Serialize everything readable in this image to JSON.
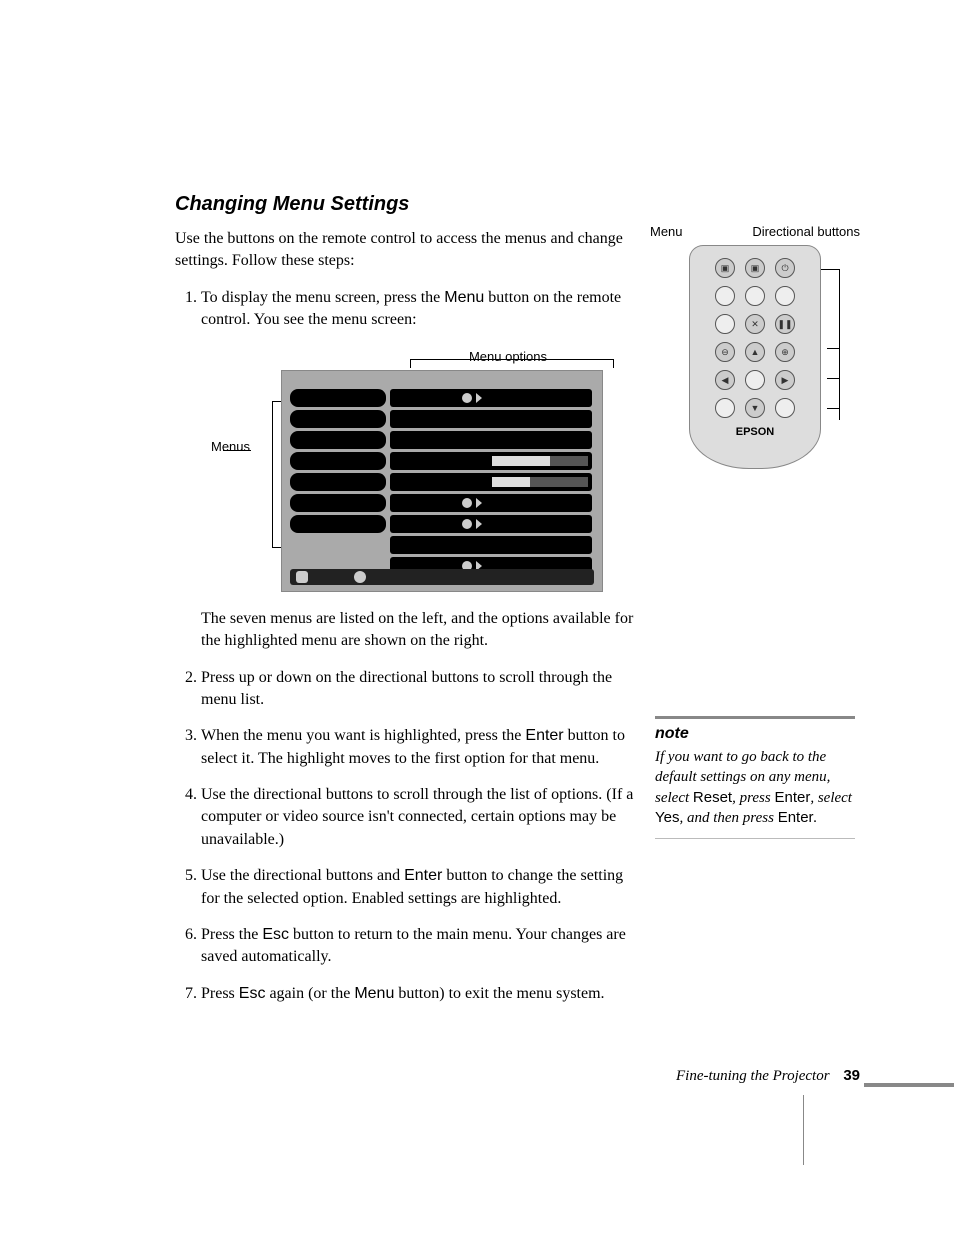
{
  "heading": "Changing Menu Settings",
  "intro": "Use the buttons on the remote control to access the menus and change settings. Follow these steps:",
  "steps": {
    "s1a": "To display the menu screen, press the ",
    "s1_menu": "Menu",
    "s1b": " button on the remote control. You see the menu screen:",
    "s1_after": "The seven menus are listed on the left, and the options available for the highlighted menu are shown on the right.",
    "s2": "Press up or down on the directional buttons to scroll through the menu list.",
    "s3a": "When the menu you want is highlighted, press the ",
    "s3_enter": "Enter",
    "s3b": " button to select it. The highlight moves to the first option for that menu.",
    "s4": "Use the directional buttons to scroll through the list of options. (If a computer or video source isn't connected, certain options may be unavailable.)",
    "s5a": "Use the directional buttons and ",
    "s5_enter": "Enter",
    "s5b": " button to change the setting for the selected option. Enabled settings are highlighted.",
    "s6a": "Press the ",
    "s6_esc": "Esc",
    "s6b": " button to return to the main menu. Your changes are saved automatically.",
    "s7a": "Press ",
    "s7_esc": "Esc",
    "s7b": " again (or the ",
    "s7_menu": "Menu",
    "s7c": " button) to exit the menu system."
  },
  "diagram": {
    "options_label": "Menu options",
    "menus_label": "Menus"
  },
  "remote": {
    "menu_label": "Menu",
    "dir_label": "Directional buttons",
    "brand": "EPSON"
  },
  "note": {
    "title": "note",
    "t1": "If you want to go back to the default settings on any menu, select ",
    "reset": "Reset",
    "t2": ", press ",
    "enter1": "Enter",
    "t3": ", select ",
    "yes": "Yes",
    "t4": ", and then press ",
    "enter2": "Enter",
    "t5": "."
  },
  "footer": {
    "chapter": "Fine-tuning the Projector",
    "page": "39"
  }
}
